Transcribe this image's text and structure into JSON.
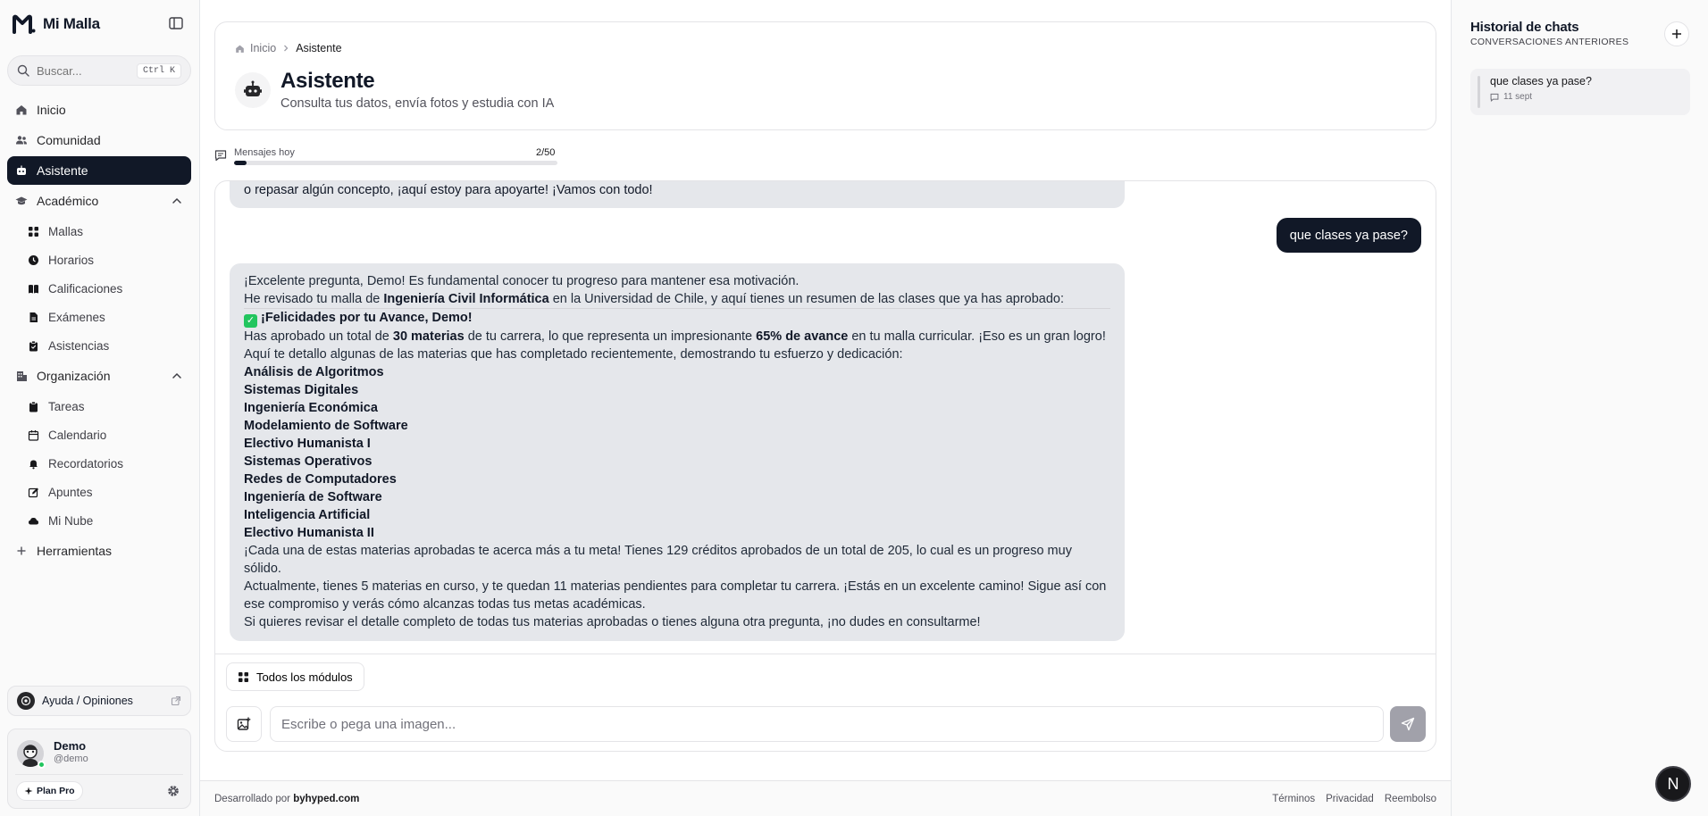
{
  "brand": {
    "name": "Mi Malla"
  },
  "search": {
    "placeholder": "Buscar...",
    "shortcut": "Ctrl K"
  },
  "nav": {
    "inicio": "Inicio",
    "comunidad": "Comunidad",
    "asistente": "Asistente",
    "academico": {
      "label": "Académico",
      "items": [
        "Mallas",
        "Horarios",
        "Calificaciones",
        "Exámenes",
        "Asistencias"
      ]
    },
    "organizacion": {
      "label": "Organización",
      "items": [
        "Tareas",
        "Calendario",
        "Recordatorios",
        "Apuntes",
        "Mi Nube"
      ]
    },
    "herramientas": "Herramientas"
  },
  "help": {
    "label": "Ayuda / Opiniones"
  },
  "user": {
    "name": "Demo",
    "handle": "@demo",
    "plan": "Plan Pro"
  },
  "header": {
    "breadcrumb_home": "Inicio",
    "breadcrumb_current": "Asistente",
    "title": "Asistente",
    "subtitle": "Consulta tus datos, envía fotos y estudia con IA"
  },
  "usage": {
    "label": "Mensajes hoy",
    "count": "2/50",
    "fraction": 0.04
  },
  "chat": {
    "prev_tail": "o repasar algún concepto, ¡aquí estoy para apoyarte! ¡Vamos con todo!",
    "user_message": "que clases ya pase?",
    "ai": {
      "intro": "¡Excelente pregunta, Demo! Es fundamental conocer tu progreso para mantener esa motivación.",
      "line2_a": "He revisado tu malla de ",
      "line2_b": "Ingeniería Civil Informática",
      "line2_c": " en la Universidad de Chile, y aquí tienes un resumen de las clases que ya has aprobado:",
      "congrats": "¡Felicidades por tu Avance, Demo!",
      "approved_a": "Has aprobado un total de ",
      "approved_b": "30 materias",
      "approved_c": " de tu carrera, lo que representa un impresionante ",
      "approved_d": "65% de avance",
      "approved_e": " en tu malla curricular. ¡Eso es un gran logro!",
      "detail": "Aquí te detallo algunas de las materias que has completado recientemente, demostrando tu esfuerzo y dedicación:",
      "subjects": [
        "Análisis de Algoritmos",
        "Sistemas Digitales",
        "Ingeniería Económica",
        "Modelamiento de Software",
        "Electivo Humanista I",
        "Sistemas Operativos",
        "Redes de Computadores",
        "Ingeniería de Software",
        "Inteligencia Artificial",
        "Electivo Humanista II"
      ],
      "credits": "¡Cada una de estas materias aprobadas te acerca más a tu meta! Tienes 129 créditos aprobados de un total de 205, lo cual es un progreso muy sólido.",
      "status": "Actualmente, tienes 5 materias en curso, y te quedan 11 materias pendientes para completar tu carrera. ¡Estás en un excelente camino! Sigue así con ese compromiso y verás cómo alcanzas todas tus metas académicas.",
      "closing": "Si quieres revisar el detalle completo de todas tus materias aprobadas o tienes alguna otra pregunta, ¡no dudes en consultarme!"
    },
    "modules_label": "Todos los módulos",
    "input_placeholder": "Escribe o pega una imagen..."
  },
  "footer": {
    "developed_by": "Desarrollado por",
    "developer": "byhyped.com",
    "links": [
      "Términos",
      "Privacidad",
      "Reembolso"
    ]
  },
  "history": {
    "title": "Historial de chats",
    "subtitle": "CONVERSACIONES ANTERIORES",
    "items": [
      {
        "title": "que clases ya pase?",
        "date": "11 sept"
      }
    ]
  },
  "fab": {
    "letter": "N"
  },
  "colors": {
    "primary": "#111827",
    "bubble": "#e5e7eb",
    "success": "#22c55e"
  }
}
